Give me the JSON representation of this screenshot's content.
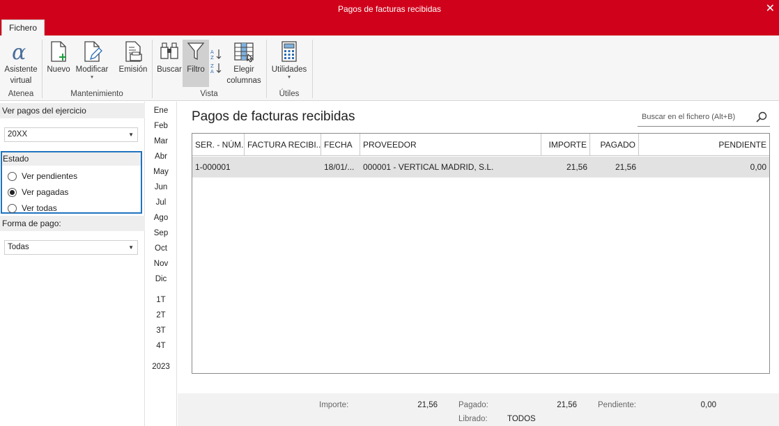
{
  "window": {
    "title": "Pagos de facturas recibidas"
  },
  "ribbon": {
    "tab": "Fichero",
    "buttons": {
      "asistente": "Asistente virtual",
      "asistente_l1": "Asistente",
      "asistente_l2": "virtual",
      "nuevo": "Nuevo",
      "modificar": "Modificar",
      "emision": "Emisión",
      "buscar": "Buscar",
      "filtro": "Filtro",
      "elegir_l1": "Elegir",
      "elegir_l2": "columnas",
      "utilidades": "Utilidades"
    },
    "groups": {
      "atenea": "Atenea",
      "mantenimiento": "Mantenimiento",
      "vista": "Vista",
      "utiles": "Útiles"
    }
  },
  "filters": {
    "ejercicio_label": "Ver pagos del ejercicio",
    "ejercicio_value": "20XX",
    "estado_label": "Estado",
    "estado_options": [
      "Ver pendientes",
      "Ver pagadas",
      "Ver todas"
    ],
    "estado_selected": "Ver pagadas",
    "forma_pago_label": "Forma de pago:",
    "forma_pago_value": "Todas"
  },
  "periods": {
    "months": [
      "Ene",
      "Feb",
      "Mar",
      "Abr",
      "May",
      "Jun",
      "Jul",
      "Ago",
      "Sep",
      "Oct",
      "Nov",
      "Dic"
    ],
    "quarters": [
      "1T",
      "2T",
      "3T",
      "4T"
    ],
    "year": "2023"
  },
  "main": {
    "title": "Pagos de facturas recibidas",
    "search_placeholder": "Buscar en el fichero (Alt+B)"
  },
  "table": {
    "columns": [
      "SER. - NÚM.",
      "FACTURA RECIBI...",
      "FECHA",
      "PROVEEDOR",
      "IMPORTE",
      "PAGADO",
      "PENDIENTE"
    ],
    "rows": [
      [
        "1-000001",
        "",
        "18/01/...",
        "000001 - VERTICAL MADRID, S.L.",
        "21,56",
        "21,56",
        "0,00"
      ]
    ]
  },
  "footer": {
    "importe_label": "Importe:",
    "importe_value": "21,56",
    "pagado_label": "Pagado:",
    "pagado_value": "21,56",
    "pendiente_label": "Pendiente:",
    "pendiente_value": "0,00",
    "librado_label": "Librado:",
    "librado_value": "TODOS"
  },
  "colors": {
    "accent": "#d0021b",
    "focus_border": "#1e73be",
    "selected_row": "#e2e2e2"
  }
}
